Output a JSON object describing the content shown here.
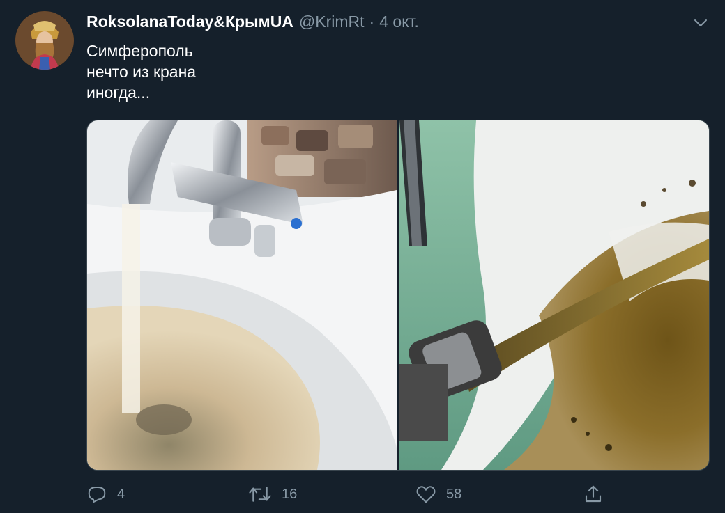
{
  "tweet": {
    "display_name": "RoksolanaToday&КрымUA",
    "handle": "@KrimRt",
    "separator": "·",
    "timestamp": "4 окт.",
    "text_lines": [
      "Симферополь",
      "нечто из крана",
      "иногда..."
    ],
    "media": [
      {
        "subject": "tap-with-brown-water-in-sink"
      },
      {
        "subject": "hose-with-brown-water-in-bathtub"
      }
    ],
    "actions": {
      "reply_count": "4",
      "retweet_count": "16",
      "like_count": "58"
    }
  },
  "icons": {
    "caret": "chevron-down-icon",
    "reply": "reply-icon",
    "retweet": "retweet-icon",
    "like": "heart-icon",
    "share": "share-icon"
  },
  "colors": {
    "background": "#15202b",
    "primary_text": "#ffffff",
    "secondary_text": "#8899a6",
    "border": "#38444d"
  }
}
